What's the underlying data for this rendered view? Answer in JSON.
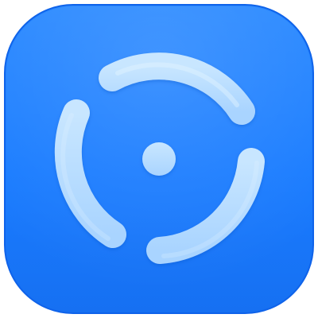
{
  "app_icon": {
    "icon_name": "circular-target-icon",
    "colors": {
      "tile": "#1a7cff",
      "tile_highlight": "#3d92ff",
      "tile_edge": "#0f63ea",
      "stroke": "#b7dcff",
      "stroke_edge": "#d9efff"
    }
  }
}
